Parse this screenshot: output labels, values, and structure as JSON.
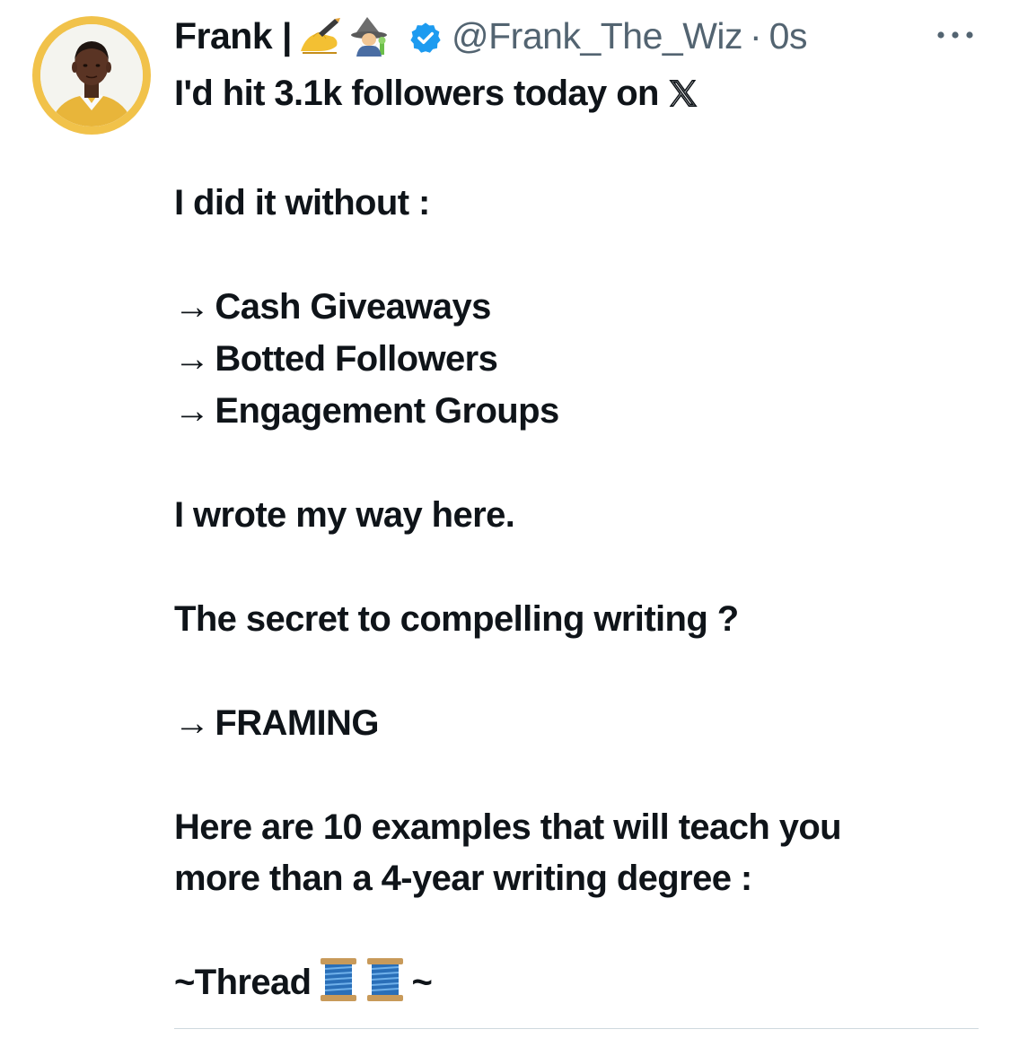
{
  "tweet": {
    "author": {
      "display_name": "Frank |",
      "name_emojis": [
        "writing-hand-icon",
        "mage-icon"
      ],
      "verified": true,
      "handle": "@Frank_The_Wiz",
      "separator": "·",
      "timestamp": "0s"
    },
    "lines": {
      "l1": "I'd hit 3.1k followers today on",
      "l2": "I did it without :",
      "l3": "Cash Giveaways",
      "l4": "Botted Followers",
      "l5": "Engagement Groups",
      "l6": "I wrote my way here.",
      "l7": "The secret to compelling writing ?",
      "l8": "FRAMING",
      "l9": "Here are 10 examples that will teach you",
      "l10": "more than a 4-year writing degree :",
      "l11_start": "~Thread",
      "l11_end": "~"
    },
    "arrow": "→",
    "icons": {
      "x_logo": "x-logo-icon",
      "thread_emoji": "spool-of-thread-icon",
      "more": "more-dots-icon",
      "verified": "verified-badge-icon"
    },
    "colors": {
      "text": "#0f1419",
      "secondary": "#536471",
      "verified_blue": "#1d9bf0",
      "avatar_ring": "#f1c24a",
      "divider": "#cfd9de"
    }
  }
}
